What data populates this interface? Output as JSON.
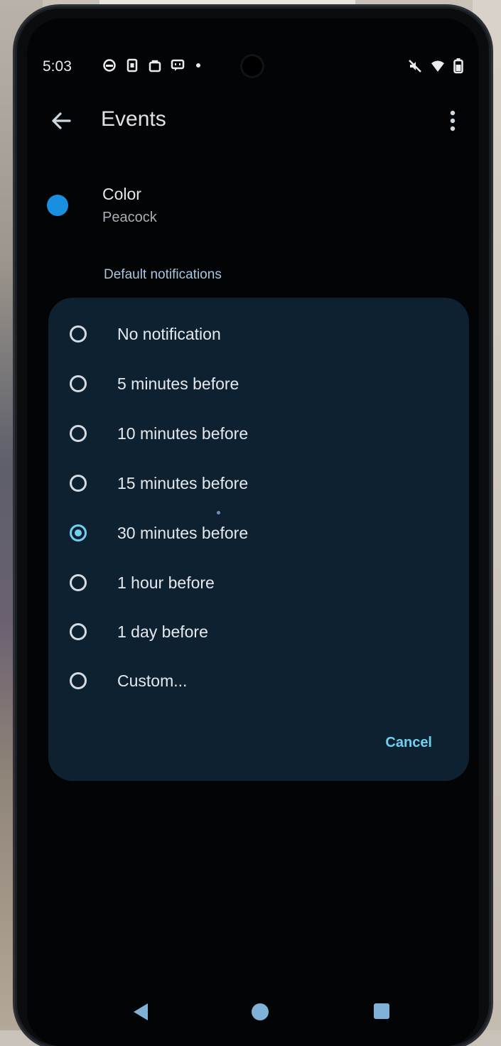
{
  "status_bar": {
    "time": "5:03",
    "icons": [
      "sim-icon",
      "sim-card-icon",
      "bag-icon",
      "message-icon",
      "notification-dot-icon",
      "mute-icon",
      "wifi-icon",
      "battery-icon"
    ]
  },
  "app_bar": {
    "title": "Events",
    "back_icon": "arrow-back-icon",
    "more_icon": "more-vert-icon"
  },
  "settings": {
    "color_label": "Color",
    "color_value": "Peacock",
    "color_hex": "#1a8fe0",
    "section_label": "Default notifications"
  },
  "dialog": {
    "options": [
      {
        "label": "No notification",
        "selected": false
      },
      {
        "label": "5 minutes before",
        "selected": false
      },
      {
        "label": "10 minutes before",
        "selected": false
      },
      {
        "label": "15 minutes before",
        "selected": false
      },
      {
        "label": "30 minutes before",
        "selected": true
      },
      {
        "label": "1 hour before",
        "selected": false
      },
      {
        "label": "1 day before",
        "selected": false
      },
      {
        "label": "Custom...",
        "selected": false
      }
    ],
    "cancel_label": "Cancel",
    "accent_color": "#6fd0f2"
  },
  "nav_bar": {
    "icons": [
      "nav-back-icon",
      "nav-home-icon",
      "nav-recents-icon"
    ]
  }
}
